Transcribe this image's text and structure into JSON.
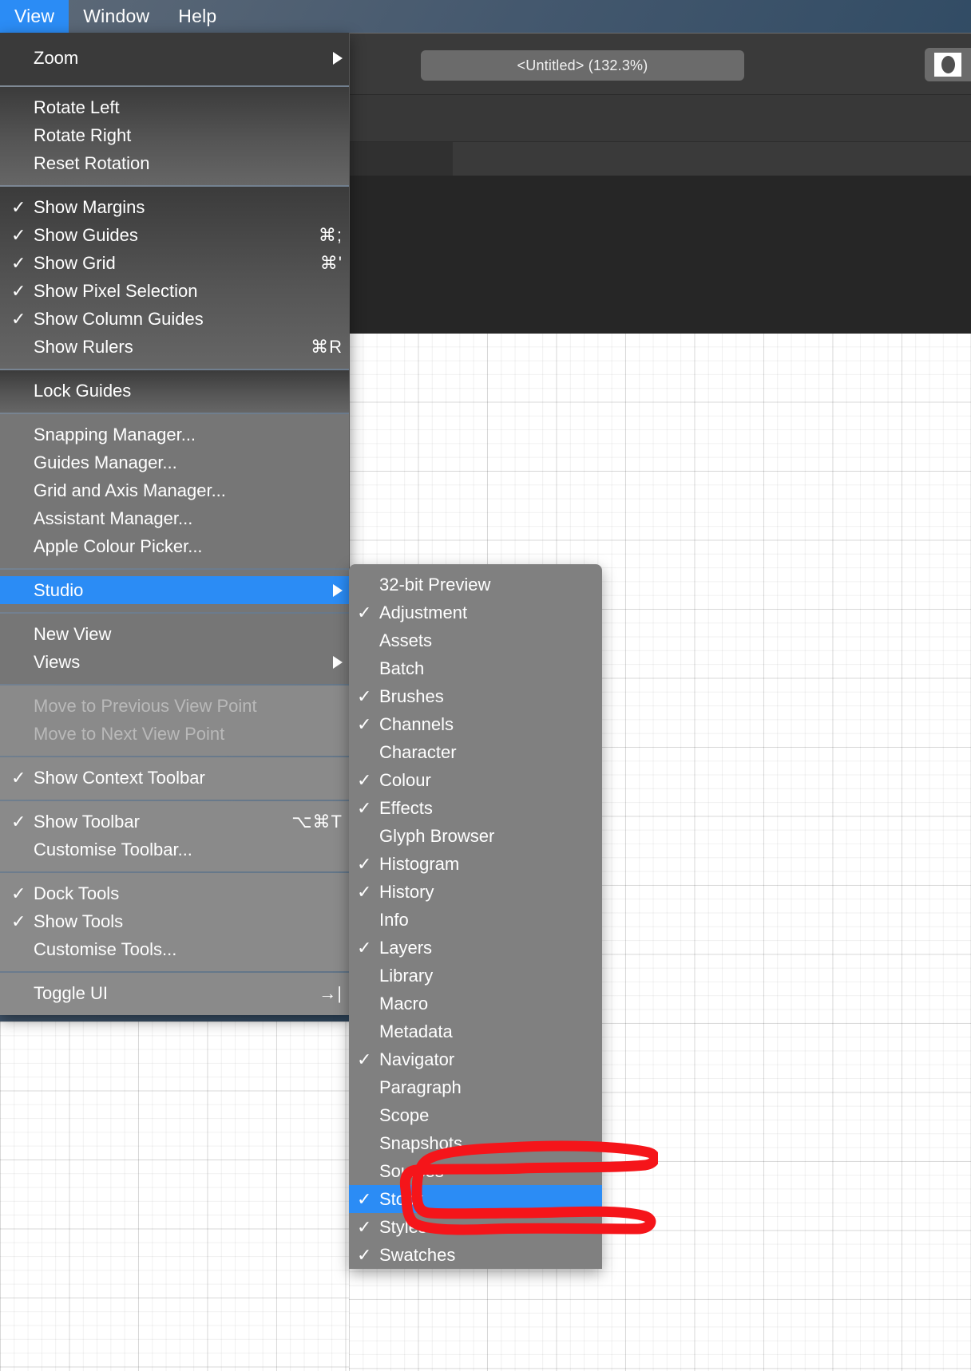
{
  "app": {
    "menubar": [
      {
        "label": "View",
        "active": true
      },
      {
        "label": "Window",
        "active": false
      },
      {
        "label": "Help",
        "active": false
      }
    ],
    "document": {
      "title_pill": "<Untitled> (132.3%)",
      "zoom_percent": "132.3%",
      "document_name": "<Untitled>"
    }
  },
  "view_menu": {
    "sections": [
      {
        "id": "zoom",
        "items": [
          {
            "label": "Zoom",
            "checked": false,
            "shortcut": "",
            "submenu": true,
            "disabled": false,
            "selected": false
          }
        ]
      },
      {
        "id": "rotation",
        "items": [
          {
            "label": "Rotate Left",
            "checked": false,
            "shortcut": "",
            "submenu": false,
            "disabled": false,
            "selected": false
          },
          {
            "label": "Rotate Right",
            "checked": false,
            "shortcut": "",
            "submenu": false,
            "disabled": false,
            "selected": false
          },
          {
            "label": "Reset Rotation",
            "checked": false,
            "shortcut": "",
            "submenu": false,
            "disabled": false,
            "selected": false
          }
        ]
      },
      {
        "id": "show-toggles",
        "items": [
          {
            "label": "Show Margins",
            "checked": true,
            "shortcut": "",
            "submenu": false,
            "disabled": false,
            "selected": false
          },
          {
            "label": "Show Guides",
            "checked": true,
            "shortcut": "⌘;",
            "submenu": false,
            "disabled": false,
            "selected": false
          },
          {
            "label": "Show Grid",
            "checked": true,
            "shortcut": "⌘'",
            "submenu": false,
            "disabled": false,
            "selected": false
          },
          {
            "label": "Show Pixel Selection",
            "checked": true,
            "shortcut": "",
            "submenu": false,
            "disabled": false,
            "selected": false
          },
          {
            "label": "Show Column Guides",
            "checked": true,
            "shortcut": "",
            "submenu": false,
            "disabled": false,
            "selected": false
          },
          {
            "label": "Show Rulers",
            "checked": false,
            "shortcut": "⌘R",
            "submenu": false,
            "disabled": false,
            "selected": false
          }
        ]
      },
      {
        "id": "lock",
        "items": [
          {
            "label": "Lock Guides",
            "checked": false,
            "shortcut": "",
            "submenu": false,
            "disabled": false,
            "selected": false
          }
        ]
      },
      {
        "id": "managers",
        "items": [
          {
            "label": "Snapping Manager...",
            "checked": false,
            "shortcut": "",
            "submenu": false,
            "disabled": false,
            "selected": false
          },
          {
            "label": "Guides Manager...",
            "checked": false,
            "shortcut": "",
            "submenu": false,
            "disabled": false,
            "selected": false
          },
          {
            "label": "Grid and Axis Manager...",
            "checked": false,
            "shortcut": "",
            "submenu": false,
            "disabled": false,
            "selected": false
          },
          {
            "label": "Assistant Manager...",
            "checked": false,
            "shortcut": "",
            "submenu": false,
            "disabled": false,
            "selected": false
          },
          {
            "label": "Apple Colour Picker...",
            "checked": false,
            "shortcut": "",
            "submenu": false,
            "disabled": false,
            "selected": false
          }
        ]
      },
      {
        "id": "studio",
        "items": [
          {
            "label": "Studio",
            "checked": false,
            "shortcut": "",
            "submenu": true,
            "disabled": false,
            "selected": true
          }
        ]
      },
      {
        "id": "views",
        "items": [
          {
            "label": "New View",
            "checked": false,
            "shortcut": "",
            "submenu": false,
            "disabled": false,
            "selected": false
          },
          {
            "label": "Views",
            "checked": false,
            "shortcut": "",
            "submenu": true,
            "disabled": false,
            "selected": false
          }
        ]
      },
      {
        "id": "viewpoints",
        "items": [
          {
            "label": "Move to Previous View Point",
            "checked": false,
            "shortcut": "",
            "submenu": false,
            "disabled": true,
            "selected": false
          },
          {
            "label": "Move to Next View Point",
            "checked": false,
            "shortcut": "",
            "submenu": false,
            "disabled": true,
            "selected": false
          }
        ]
      },
      {
        "id": "context-toolbar",
        "items": [
          {
            "label": "Show Context Toolbar",
            "checked": true,
            "shortcut": "",
            "submenu": false,
            "disabled": false,
            "selected": false
          }
        ]
      },
      {
        "id": "toolbar",
        "items": [
          {
            "label": "Show Toolbar",
            "checked": true,
            "shortcut": "⌥⌘T",
            "submenu": false,
            "disabled": false,
            "selected": false
          },
          {
            "label": "Customise Toolbar...",
            "checked": false,
            "shortcut": "",
            "submenu": false,
            "disabled": false,
            "selected": false
          }
        ]
      },
      {
        "id": "tools",
        "items": [
          {
            "label": "Dock Tools",
            "checked": true,
            "shortcut": "",
            "submenu": false,
            "disabled": false,
            "selected": false
          },
          {
            "label": "Show Tools",
            "checked": true,
            "shortcut": "",
            "submenu": false,
            "disabled": false,
            "selected": false
          },
          {
            "label": "Customise Tools...",
            "checked": false,
            "shortcut": "",
            "submenu": false,
            "disabled": false,
            "selected": false
          }
        ]
      },
      {
        "id": "toggle-ui",
        "items": [
          {
            "label": "Toggle UI",
            "checked": false,
            "shortcut": "→|",
            "submenu": false,
            "disabled": false,
            "selected": false
          }
        ]
      }
    ]
  },
  "studio_submenu": {
    "parent": "Studio",
    "items": [
      {
        "label": "32-bit Preview",
        "checked": false,
        "selected": false
      },
      {
        "label": "Adjustment",
        "checked": true,
        "selected": false
      },
      {
        "label": "Assets",
        "checked": false,
        "selected": false
      },
      {
        "label": "Batch",
        "checked": false,
        "selected": false
      },
      {
        "label": "Brushes",
        "checked": true,
        "selected": false
      },
      {
        "label": "Channels",
        "checked": true,
        "selected": false
      },
      {
        "label": "Character",
        "checked": false,
        "selected": false
      },
      {
        "label": "Colour",
        "checked": true,
        "selected": false
      },
      {
        "label": "Effects",
        "checked": true,
        "selected": false
      },
      {
        "label": "Glyph Browser",
        "checked": false,
        "selected": false
      },
      {
        "label": "Histogram",
        "checked": true,
        "selected": false
      },
      {
        "label": "History",
        "checked": true,
        "selected": false
      },
      {
        "label": "Info",
        "checked": false,
        "selected": false
      },
      {
        "label": "Layers",
        "checked": true,
        "selected": false
      },
      {
        "label": "Library",
        "checked": false,
        "selected": false
      },
      {
        "label": "Macro",
        "checked": false,
        "selected": false
      },
      {
        "label": "Metadata",
        "checked": false,
        "selected": false
      },
      {
        "label": "Navigator",
        "checked": true,
        "selected": false
      },
      {
        "label": "Paragraph",
        "checked": false,
        "selected": false
      },
      {
        "label": "Scope",
        "checked": false,
        "selected": false
      },
      {
        "label": "Snapshots",
        "checked": false,
        "selected": false
      },
      {
        "label": "Sources",
        "checked": false,
        "selected": false
      },
      {
        "label": "Stock",
        "checked": true,
        "selected": true
      },
      {
        "label": "Styles",
        "checked": true,
        "selected": false
      },
      {
        "label": "Swatches",
        "checked": true,
        "selected": false
      }
    ]
  },
  "annotation": {
    "type": "hand-drawn-circle",
    "color": "#f5151a",
    "targets": "Stock"
  },
  "glyphs": {
    "check": "✓",
    "submenu_arrow": "▶"
  },
  "colors": {
    "accent_blue": "#2b8cf5",
    "annotation_red": "#f5151a",
    "menu_dark": "#3a3a3a",
    "menu_light": "#8a8a8a",
    "submenu_bg": "#808080"
  }
}
